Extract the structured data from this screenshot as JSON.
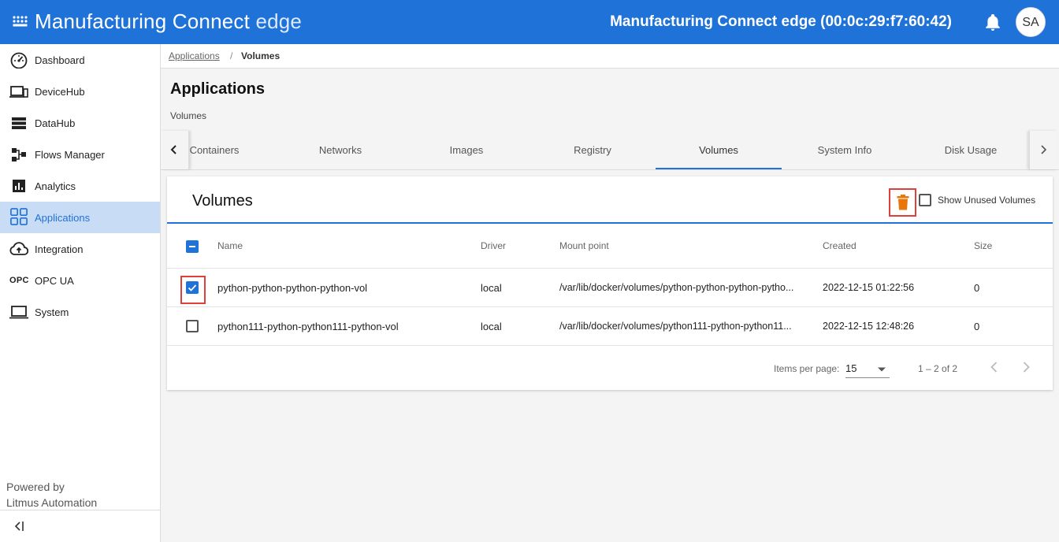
{
  "header": {
    "brand_main": "Manufacturing Connect",
    "brand_light": " edge",
    "device_title": "Manufacturing Connect edge (00:0c:29:f7:60:42)",
    "avatar_initials": "SA"
  },
  "sidebar": {
    "items": [
      {
        "label": "Dashboard",
        "icon": "gauge-icon"
      },
      {
        "label": "DeviceHub",
        "icon": "devices-icon"
      },
      {
        "label": "DataHub",
        "icon": "storage-icon"
      },
      {
        "label": "Flows Manager",
        "icon": "flows-icon"
      },
      {
        "label": "Analytics",
        "icon": "analytics-icon"
      },
      {
        "label": "Applications",
        "icon": "apps-grid-icon"
      },
      {
        "label": "Integration",
        "icon": "cloud-upload-icon"
      },
      {
        "label": "OPC UA",
        "icon": "opc-icon",
        "icon_text": "OPC"
      },
      {
        "label": "System",
        "icon": "laptop-icon"
      }
    ],
    "active": "Applications",
    "powered_line1": "Powered by",
    "powered_line2": "Litmus Automation"
  },
  "breadcrumb": {
    "parent": "Applications",
    "separator": "/",
    "current": "Volumes"
  },
  "page": {
    "title": "Applications",
    "subtitle": "Volumes"
  },
  "tabs": {
    "items": [
      "Containers",
      "Networks",
      "Images",
      "Registry",
      "Volumes",
      "System Info",
      "Disk Usage"
    ],
    "active": "Volumes"
  },
  "card": {
    "title": "Volumes",
    "show_unused_label": "Show Unused Volumes",
    "show_unused_checked": false,
    "columns": {
      "name": "Name",
      "driver": "Driver",
      "mount": "Mount point",
      "created": "Created",
      "size": "Size"
    },
    "rows": [
      {
        "checked": true,
        "name": "python-python-python-python-vol",
        "driver": "local",
        "mount": "/var/lib/docker/volumes/python-python-python-pytho...",
        "created": "2022-12-15 01:22:56",
        "size": "0"
      },
      {
        "checked": false,
        "name": "python111-python-python111-python-vol",
        "driver": "local",
        "mount": "/var/lib/docker/volumes/python111-python-python11...",
        "created": "2022-12-15 12:48:26",
        "size": "0"
      }
    ],
    "paginator": {
      "items_per_page_label": "Items per page:",
      "items_per_page": "15",
      "range": "1 – 2 of 2"
    }
  },
  "colors": {
    "primary": "#1f72d8",
    "highlight": "#e0403a",
    "trash": "#e8760a",
    "active_nav_bg": "#c9dcf5"
  }
}
